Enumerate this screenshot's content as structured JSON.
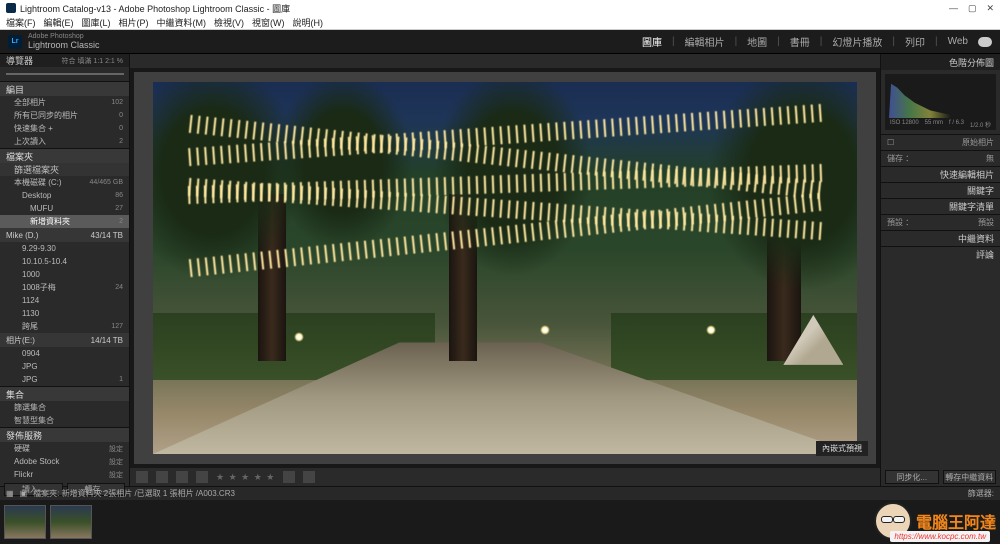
{
  "window": {
    "title": "Lightroom Catalog-v13 - Adobe Photoshop Lightroom Classic - 圖庫"
  },
  "menu": [
    "檔案(F)",
    "編輯(E)",
    "圖庫(L)",
    "相片(P)",
    "中繼資料(M)",
    "檢視(V)",
    "視窗(W)",
    "說明(H)"
  ],
  "brand": {
    "small": "Adobe Photoshop",
    "name": "Lightroom Classic"
  },
  "modules": [
    "圖庫",
    "編輯相片",
    "地圖",
    "書冊",
    "幻燈片播放",
    "列印",
    "Web"
  ],
  "left": {
    "navigator": "導覽器",
    "nav_right": "符合  填滿  1:1  2:1 %",
    "catalog_head": "編目",
    "catalog_items": [
      {
        "label": "全部相片",
        "count": "102"
      },
      {
        "label": "所有已同步的相片",
        "count": "0"
      },
      {
        "label": "快速集合 +",
        "count": "0"
      },
      {
        "label": "上次讀入",
        "count": "2"
      }
    ],
    "folders_head": "檔案夾",
    "filter_label": "篩選檔案夾",
    "drives": [
      {
        "label": "本機磁碟 (C:)",
        "count": "44/465 GB"
      }
    ],
    "folders": [
      {
        "label": "Desktop",
        "count": "86",
        "indent": 1
      },
      {
        "label": "MUFU",
        "count": "27",
        "indent": 2
      },
      {
        "label": "新增資料夾",
        "count": "2",
        "indent": 2,
        "selected": true
      },
      {
        "label": "Mike (D.)",
        "count": "43/14 TB",
        "indent": 0,
        "head": true
      },
      {
        "label": "9.29-9.30",
        "count": "",
        "indent": 1
      },
      {
        "label": "10.10.5-10.4",
        "count": "",
        "indent": 1
      },
      {
        "label": "1000",
        "count": "",
        "indent": 1
      },
      {
        "label": "1008子梅",
        "count": "24",
        "indent": 1
      },
      {
        "label": "1124",
        "count": "",
        "indent": 1
      },
      {
        "label": "1130",
        "count": "",
        "indent": 1
      },
      {
        "label": "跨尾",
        "count": "127",
        "indent": 1
      },
      {
        "label": "相片(E:)",
        "count": "14/14 TB",
        "indent": 0,
        "head": true
      },
      {
        "label": "0904",
        "count": "",
        "indent": 1
      },
      {
        "label": "JPG",
        "count": "",
        "indent": 1
      },
      {
        "label": "JPG",
        "count": "1",
        "indent": 1
      }
    ],
    "collections_head": "集合",
    "collections": [
      {
        "label": "篩選集合",
        "count": ""
      },
      {
        "label": "智慧型集合",
        "count": ""
      }
    ],
    "publish_head": "發佈服務",
    "publish": [
      {
        "label": "硬碟",
        "count": "設定"
      },
      {
        "label": "Adobe Stock",
        "count": "設定"
      },
      {
        "label": "Flickr",
        "count": "設定"
      }
    ],
    "btn_import": "讀入...",
    "btn_export": "轉存..."
  },
  "viewer": {
    "overlay_label": "內嵌式預視"
  },
  "toolbar": {
    "stars": "★ ★ ★ ★ ★"
  },
  "right": {
    "histogram_head": "色階分佈圖",
    "exif": [
      "ISO 12800",
      "55 mm",
      "f / 6.3",
      "1/2.0 秒"
    ],
    "original": "原始相片",
    "rows": [
      "快速編輯相片",
      "關鍵字",
      "關鍵字清單",
      "中繼資料",
      "評論"
    ],
    "sub1_l": "儲存   ：",
    "sub1_r": "無",
    "sub2_l": "預設   ：",
    "sub2_r": "預設"
  },
  "right_buttons": {
    "sync": "同步化...",
    "sync_settings": "轉存中繼資料"
  },
  "filmstrip": {
    "path": "檔案夾: 新增資料夾   2張相片 /已選取 1 張相片 /A003.CR3",
    "filter": "篩選器:"
  },
  "watermark": {
    "text": "電腦王阿達",
    "url": "https://www.kocpc.com.tw"
  }
}
